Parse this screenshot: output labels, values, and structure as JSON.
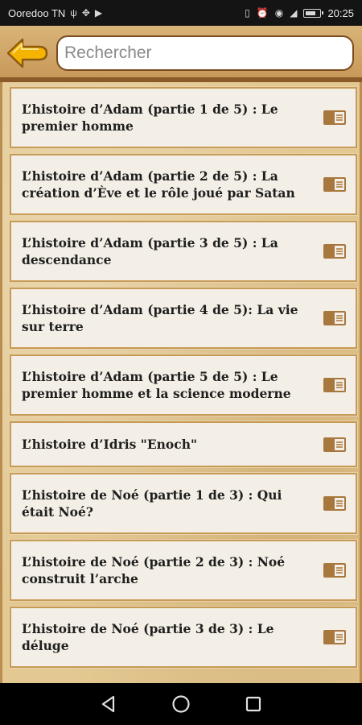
{
  "status_bar": {
    "carrier": "Ooredoo TN",
    "time": "20:25"
  },
  "header": {
    "search_placeholder": "Rechercher"
  },
  "list": {
    "items": [
      {
        "title": "L’histoire d’Adam (partie 1 de 5) : Le premier homme",
        "lines": 2
      },
      {
        "title": "L’histoire d’Adam (partie 2 de 5) : La création d’Ève et le rôle joué par Satan",
        "lines": 2
      },
      {
        "title": "L’histoire d’Adam (partie 3 de 5) : La descendance",
        "lines": 2
      },
      {
        "title": "L’histoire d’Adam (partie 4 de 5): La vie sur terre",
        "lines": 2
      },
      {
        "title": "L’histoire d’Adam (partie 5 de 5) : Le premier homme et la science moderne",
        "lines": 2
      },
      {
        "title": "L’histoire d’Idris \"Enoch\"",
        "lines": 1
      },
      {
        "title": "L’histoire de Noé (partie 1 de 3) : Qui était Noé?",
        "lines": 2
      },
      {
        "title": "L’histoire de Noé (partie 2 de 3) : Noé construit l’arche",
        "lines": 2
      },
      {
        "title": "L’histoire de Noé (partie 3 de 3) : Le déluge",
        "lines": 2
      }
    ]
  },
  "colors": {
    "accent": "#f5b400",
    "frame": "#c79a57",
    "book_icon": "#a8773d"
  },
  "icons": {
    "back": "arrow-left-icon",
    "item": "book-icon",
    "nav_back": "triangle-back-icon",
    "nav_home": "circle-home-icon",
    "nav_recent": "square-recent-icon"
  }
}
